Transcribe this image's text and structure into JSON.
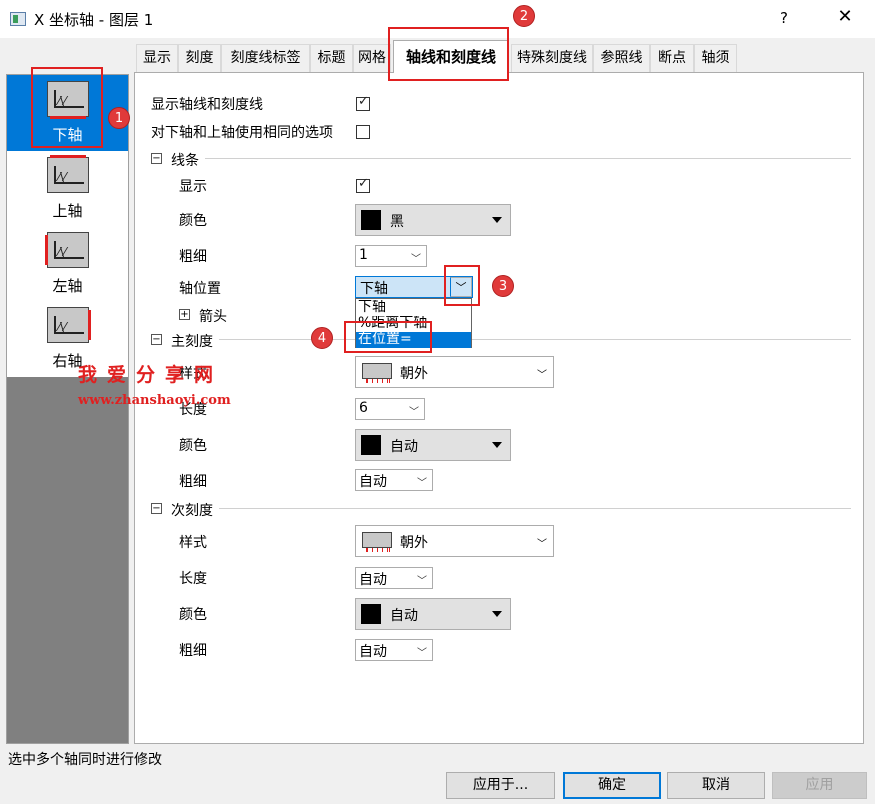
{
  "window": {
    "title": "X 坐标轴 - 图层 1",
    "help": "?",
    "close": "✕"
  },
  "sidebar": {
    "items": [
      {
        "label": "下轴",
        "selected": true
      },
      {
        "label": "上轴",
        "selected": false
      },
      {
        "label": "左轴",
        "selected": false
      },
      {
        "label": "右轴",
        "selected": false
      }
    ]
  },
  "tabs": [
    "显示",
    "刻度",
    "刻度线标签",
    "标题",
    "网格",
    "轴线和刻度线",
    "特殊刻度线",
    "参照线",
    "断点",
    "轴须"
  ],
  "active_tab": "轴线和刻度线",
  "options": {
    "show_axis_ticks": {
      "label": "显示轴线和刻度线",
      "checked": true
    },
    "same_options": {
      "label": "对下轴和上轴使用相同的选项",
      "checked": false
    }
  },
  "line_section": {
    "title": "线条",
    "show_label": "显示",
    "show_checked": true,
    "color_label": "颜色",
    "color_value": "黑",
    "thickness_label": "粗细",
    "thickness_value": "1",
    "axis_pos_label": "轴位置",
    "axis_pos_value": "下轴",
    "axis_pos_options": [
      "下轴",
      "%距离下轴",
      "在位置="
    ],
    "axis_pos_highlight": "在位置=",
    "arrow_label": "箭头"
  },
  "major_section": {
    "title": "主刻度",
    "style_label": "样式",
    "style_value": "朝外",
    "length_label": "长度",
    "length_value": "6",
    "color_label": "颜色",
    "color_value": "自动",
    "thickness_label": "粗细",
    "thickness_value": "自动"
  },
  "minor_section": {
    "title": "次刻度",
    "style_label": "样式",
    "style_value": "朝外",
    "length_label": "长度",
    "length_value": "自动",
    "color_label": "颜色",
    "color_value": "自动",
    "thickness_label": "粗细",
    "thickness_value": "自动"
  },
  "annotations": {
    "badge1": "1",
    "badge2": "2",
    "badge3": "3",
    "badge4": "4"
  },
  "watermark": {
    "text": "我爱分享网",
    "url": "www.zhanshaoyi.com"
  },
  "status_text": "选中多个轴同时进行修改",
  "buttons": {
    "apply_to": "应用于...",
    "ok": "确定",
    "cancel": "取消",
    "apply": "应用"
  },
  "colors": {
    "accent": "#0078d7",
    "annotation_red": "#e02020"
  }
}
